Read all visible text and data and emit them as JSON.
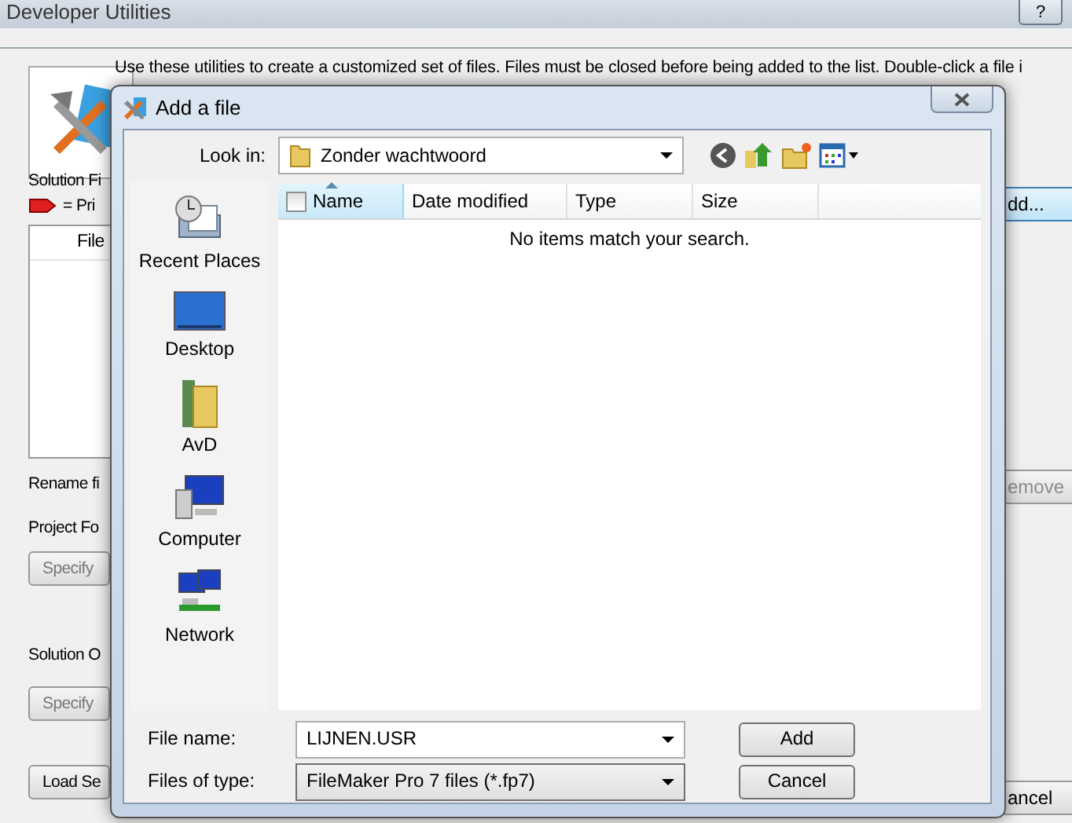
{
  "background_window": {
    "title": "Developer Utilities",
    "help_button": "?",
    "description_lines": [
      "Use these utilities to create a customized set of files. Files must be closed before being added to the list. Double-click a file i"
    ],
    "solution_files_label": "Solution Fi",
    "primary_legend": "= Pri",
    "file_list_header": "File",
    "rename_label": "Rename fi",
    "project_folder_label": "Project Fo",
    "project_specify_button": "Specify",
    "solution_options_label": "Solution O",
    "options_specify_button": "Specify",
    "load_button": "Load Se",
    "add_button": "dd...",
    "remove_button": {
      "label": "emove",
      "disabled": true
    },
    "cancel_button": "ancel"
  },
  "dialog": {
    "title": "Add a file",
    "look_in_label": "Look in:",
    "look_in_value": "Zonder wachtwoord",
    "places": [
      {
        "kind": "recent",
        "label": "Recent Places"
      },
      {
        "kind": "desktop",
        "label": "Desktop"
      },
      {
        "kind": "user",
        "label": "AvD"
      },
      {
        "kind": "computer",
        "label": "Computer"
      },
      {
        "kind": "network",
        "label": "Network"
      }
    ],
    "select_all_checked": false,
    "columns": [
      {
        "label": "Name",
        "sorted": true
      },
      {
        "label": "Date modified",
        "sorted": false
      },
      {
        "label": "Type",
        "sorted": false
      },
      {
        "label": "Size",
        "sorted": false
      }
    ],
    "empty_message": "No items match your search.",
    "file_name_label": "File name:",
    "file_name_value": "LIJNEN.USR",
    "file_type_label": "Files of type:",
    "file_type_value": "FileMaker Pro 7 files (*.fp7)",
    "buttons": [
      "Add",
      "Cancel"
    ]
  }
}
